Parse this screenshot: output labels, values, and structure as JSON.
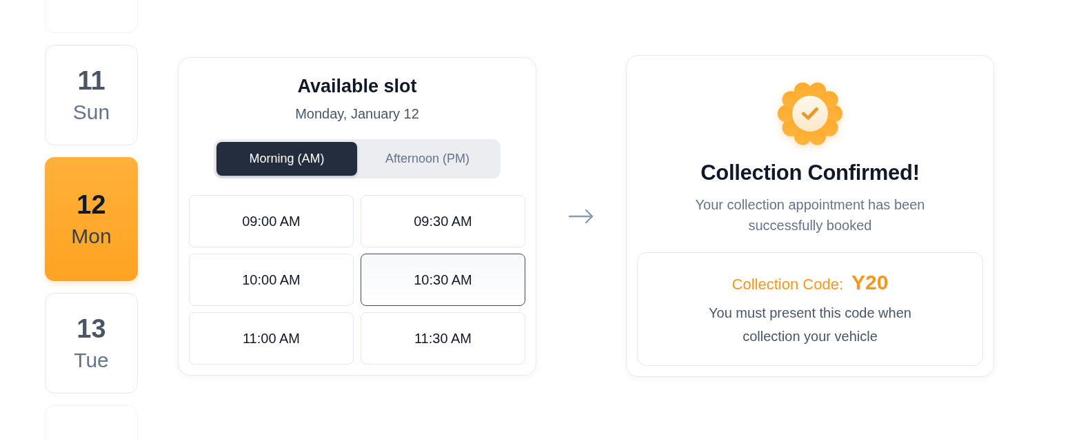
{
  "date_strip": {
    "cut_top": true,
    "cut_bottom": true,
    "dates": [
      {
        "day": "11",
        "weekday": "Sun",
        "selected": false
      },
      {
        "day": "12",
        "weekday": "Mon",
        "selected": true
      },
      {
        "day": "13",
        "weekday": "Tue",
        "selected": false
      }
    ]
  },
  "slot_panel": {
    "title": "Available slot",
    "date": "Monday, January 12",
    "periods": [
      {
        "label": "Morning (AM)",
        "selected": true
      },
      {
        "label": "Afternoon (PM)",
        "selected": false
      }
    ],
    "slots": [
      {
        "time": "09:00 AM",
        "selected": false
      },
      {
        "time": "09:30 AM",
        "selected": false
      },
      {
        "time": "10:00 AM",
        "selected": false
      },
      {
        "time": "10:30 AM",
        "selected": true
      },
      {
        "time": "11:00 AM",
        "selected": false
      },
      {
        "time": "11:30 AM",
        "selected": false
      }
    ]
  },
  "confirmation": {
    "title": "Collection Confirmed!",
    "message": "Your collection appointment has been successfully booked",
    "code_label": "Collection Code:",
    "code": "Y20",
    "note": "You must present this code when collection your vehicle"
  }
}
